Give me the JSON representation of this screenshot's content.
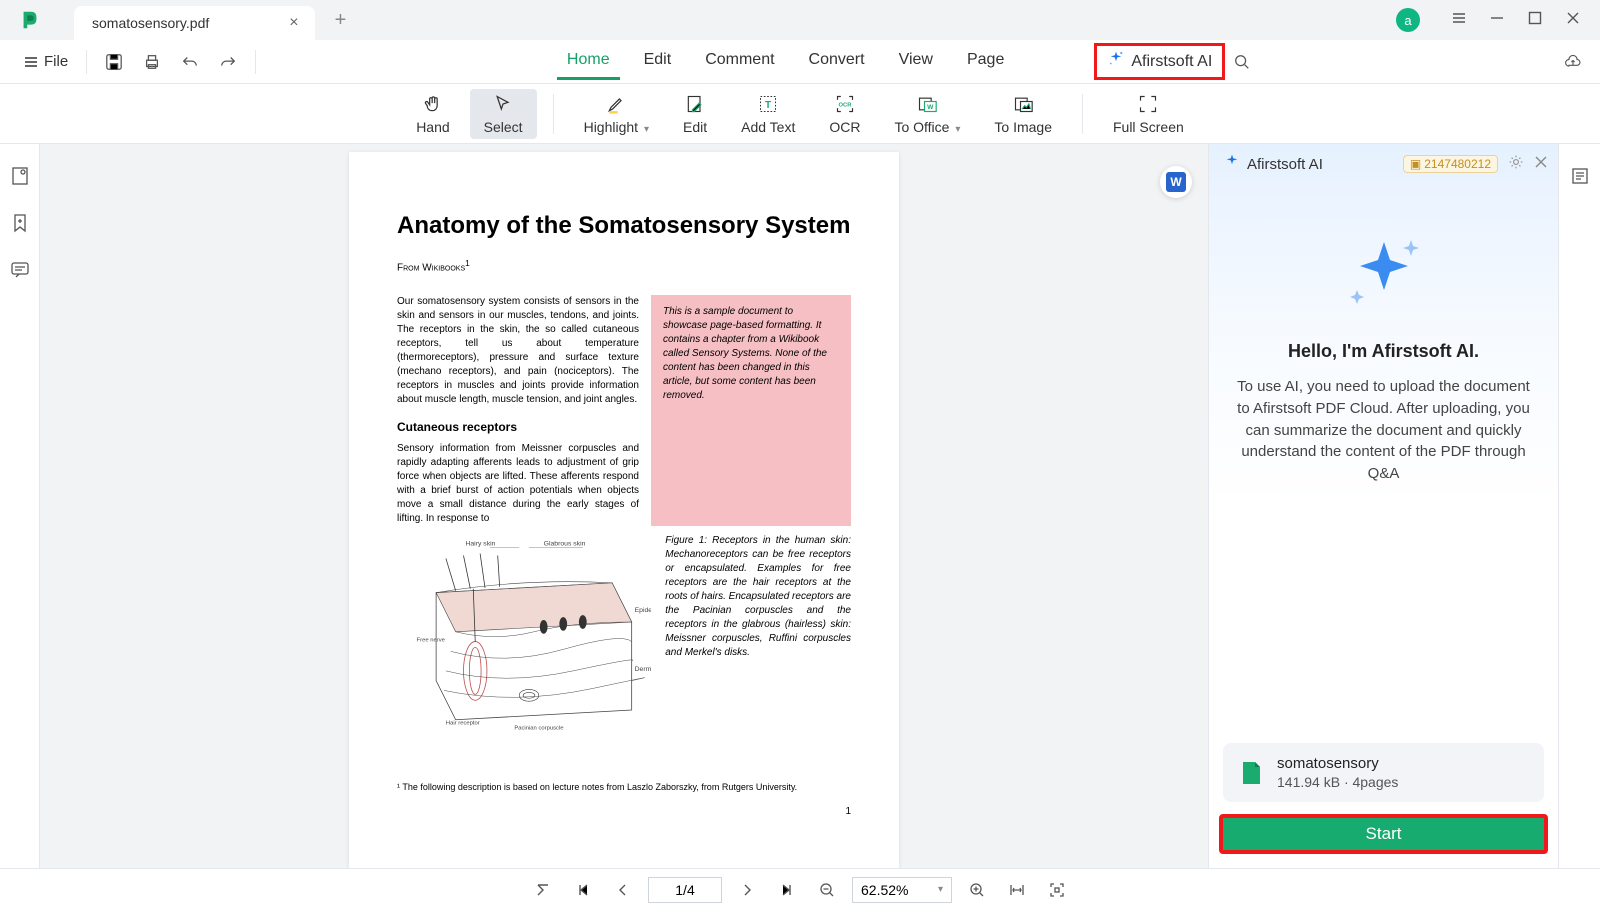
{
  "window": {
    "tab_title": "somatosensory.pdf",
    "user_initial": "a"
  },
  "menu": {
    "file": "File",
    "tabs": [
      "Home",
      "Edit",
      "Comment",
      "Convert",
      "View",
      "Page"
    ],
    "active_tab": 0,
    "ai_label": "Afirstsoft AI"
  },
  "toolbar": {
    "hand": "Hand",
    "select": "Select",
    "highlight": "Highlight",
    "edit": "Edit",
    "add_text": "Add Text",
    "ocr": "OCR",
    "to_office": "To Office",
    "to_image": "To Image",
    "full_screen": "Full Screen",
    "selected": "select"
  },
  "document": {
    "title": "Anatomy of the Somatosensory System",
    "from_line": "From Wikibooks",
    "para1": "Our somatosensory system consists of sensors in the skin and sensors in our muscles, tendons, and joints. The receptors in the skin, the so called cutaneous receptors, tell us about temperature (thermoreceptors), pressure and surface texture (mechano receptors), and pain (nociceptors). The receptors in muscles and joints provide information about muscle length, muscle tension, and joint angles.",
    "callout": "This is a sample document to showcase page-based formatting. It contains a chapter from a Wikibook called Sensory Systems. None of the content has been changed in this article, but some content has been removed.",
    "subhead": "Cutaneous receptors",
    "para2": "Sensory information from Meissner corpuscles and rapidly adapting afferents leads to adjustment of grip force when objects are lifted. These afferents respond with a brief burst of action potentials when objects move a small distance during the early stages of lifting. In response to",
    "fig_labels": {
      "hairy": "Hairy skin",
      "glabrous": "Glabrous skin",
      "epidermis": "Epidermis",
      "dermis": "Dermis"
    },
    "fig_caption": "Figure 1: Receptors in the human skin: Mechanoreceptors can be free receptors or encapsulated. Examples for free receptors are the hair receptors at the roots of hairs. Encapsulated receptors are the Pacinian corpuscles and the receptors in the glabrous (hairless) skin: Meissner corpuscles, Ruffini corpuscles and Merkel's disks.",
    "footnote": "¹ The following description is based on lecture notes from Laszlo Zaborszky, from Rutgers University.",
    "page_num": "1"
  },
  "ai_panel": {
    "title": "Afirstsoft AI",
    "id": "2147480212",
    "greeting": "Hello, I'm Afirstsoft AI.",
    "desc": "To use AI, you need to upload the document to Afirstsoft PDF Cloud. After uploading, you can summarize the document and quickly understand the content of the PDF through Q&A",
    "file_name": "somatosensory",
    "file_meta": "141.94 kB · 4pages",
    "start": "Start"
  },
  "footer": {
    "page": "1/4",
    "zoom": "62.52%"
  }
}
